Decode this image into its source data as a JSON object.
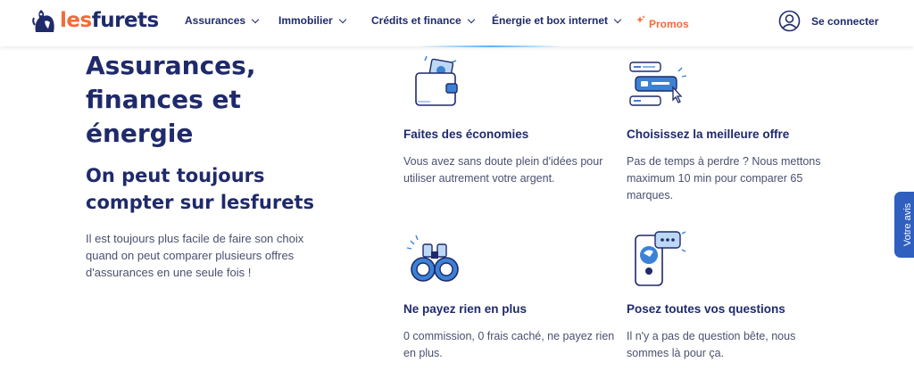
{
  "brand": {
    "logo_part1": "les",
    "logo_part2": "furets",
    "primary_color": "#1f2a6b",
    "accent_color": "#f26b3a",
    "icon_blue": "#3b82d6"
  },
  "nav": {
    "items": [
      {
        "label": "Assurances"
      },
      {
        "label": "Immobilier"
      },
      {
        "label": "Crédits et finance"
      },
      {
        "label": "Énergie et box internet"
      }
    ],
    "promos_label": "Promos",
    "connect_label": "Se connecter"
  },
  "hero": {
    "title": "Assurances, finances et énergie",
    "subtitle": "On peut toujours compter sur lesfurets",
    "description": "Il est toujours plus facile de faire son choix quand on peut comparer plusieurs offres d'assurances en une seule fois !"
  },
  "features": [
    {
      "icon": "wallet-icon",
      "title": "Faites des économies",
      "text": "Vous avez sans doute plein d'idées pour utiliser autrement votre argent."
    },
    {
      "icon": "offer-cards-icon",
      "title": "Choisissez la meilleure offre",
      "text": "Pas de temps à perdre ? Nous mettons maximum 10 min pour comparer 65 marques."
    },
    {
      "icon": "binoculars-icon",
      "title": "Ne payez rien en plus",
      "text": "0 commission, 0 frais caché, ne payez rien en plus."
    },
    {
      "icon": "phone-chat-icon",
      "title": "Posez toutes vos questions",
      "text": "Il n'y a pas de question bête, nous sommes là pour ça."
    }
  ],
  "feedback_tab": {
    "label": "Votre avis"
  }
}
